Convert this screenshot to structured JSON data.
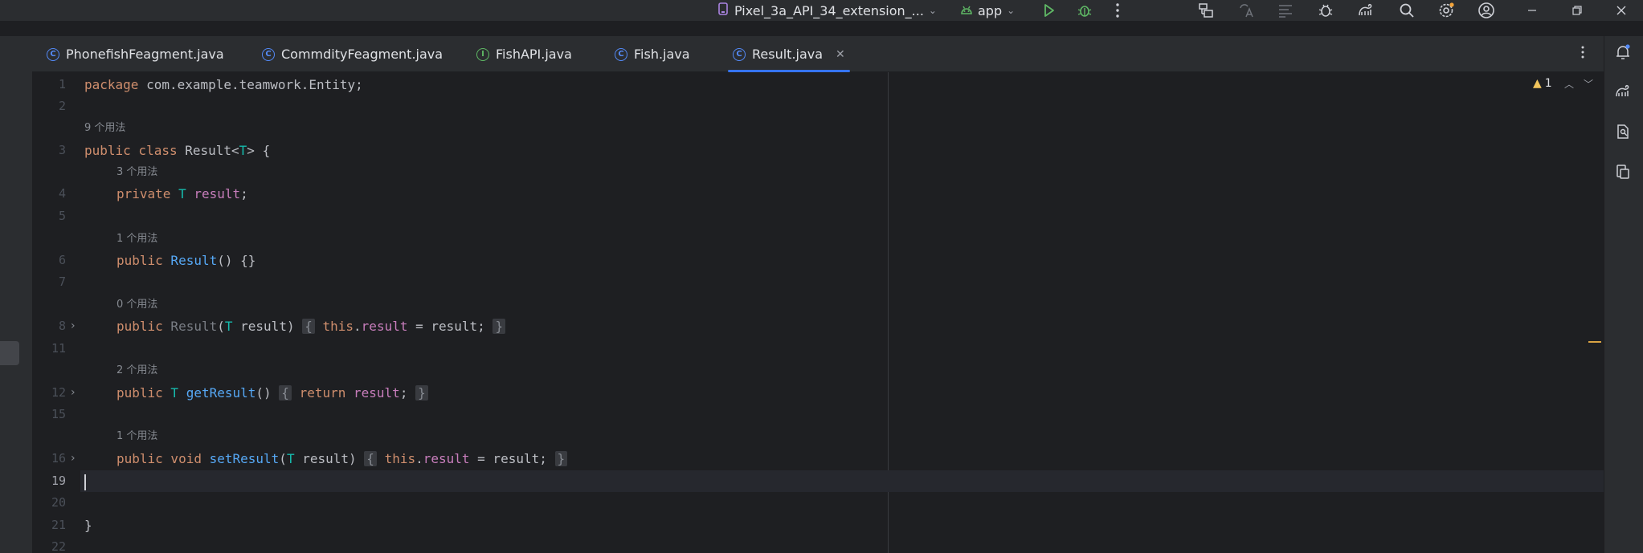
{
  "toolbar": {
    "device_label": "Pixel_3a_API_34_extension_...",
    "module_label": "app",
    "icons": [
      "device-manager-icon",
      "android-icon",
      "run-icon",
      "debug-icon",
      "more-icon",
      "project-structure-icon",
      "translate-icon",
      "filter-icon",
      "bug-icon",
      "gradle-icon",
      "search-icon",
      "settings-icon",
      "account-icon",
      "minimize-icon",
      "restore-icon",
      "close-icon"
    ]
  },
  "tabs": [
    {
      "label": "PhonefishFeagment.java",
      "kind": "class"
    },
    {
      "label": "CommdityFeagment.java",
      "kind": "class"
    },
    {
      "label": "FishAPI.java",
      "kind": "interface"
    },
    {
      "label": "Fish.java",
      "kind": "class"
    },
    {
      "label": "Result.java",
      "kind": "class",
      "active": true
    }
  ],
  "editor": {
    "line_numbers": [
      "1",
      "2",
      "3",
      "4",
      "5",
      "6",
      "7",
      "8",
      "11",
      "12",
      "15",
      "16",
      "19",
      "20",
      "21",
      "22"
    ],
    "usage_hints": [
      "9 个用法",
      "3 个用法",
      "1 个用法",
      "0 个用法",
      "2 个用法",
      "1 个用法"
    ],
    "code": {
      "l1_kw": "package",
      "l1_rest": " com.example.teamwork.Entity;",
      "l3_kw": "public class",
      "l3_name": " Result<",
      "l3_tp": "T",
      "l3_end": "> {",
      "l4_kw": "private",
      "l4_tp": " T",
      "l4_fld": " result",
      "l4_end": ";",
      "l6_kw": "public",
      "l6_fn": " Result",
      "l6_end": "() {}",
      "l8_kw": "public",
      "l8_fn": " Result",
      "l8_open": "(",
      "l8_tp": "T",
      "l8_param": " result)",
      "l8_lb": "{",
      "l8_this": "this",
      "l8_dot": ".",
      "l8_fld": "result",
      "l8_assign": " = result;",
      "l8_rb": "}",
      "l12_kw": "public",
      "l12_tp": " T",
      "l12_fn": " getResult",
      "l12_paren": "()",
      "l12_lb": "{",
      "l12_ret": "return",
      "l12_fld": " result",
      "l12_semi": ";",
      "l12_rb": "}",
      "l16_kw": "public void",
      "l16_fn": " setResult",
      "l16_open": "(",
      "l16_tp": "T",
      "l16_param": " result)",
      "l16_lb": "{",
      "l16_this": "this",
      "l16_dot": ".",
      "l16_fld": "result",
      "l16_assign": " = result;",
      "l16_rb": "}",
      "l21": "}"
    },
    "warning_count": "1"
  },
  "colors": {
    "keyword": "#cf8e6d",
    "type_param": "#16baac",
    "function": "#56a8f5",
    "field": "#c77dbb",
    "accent": "#3574f0"
  }
}
